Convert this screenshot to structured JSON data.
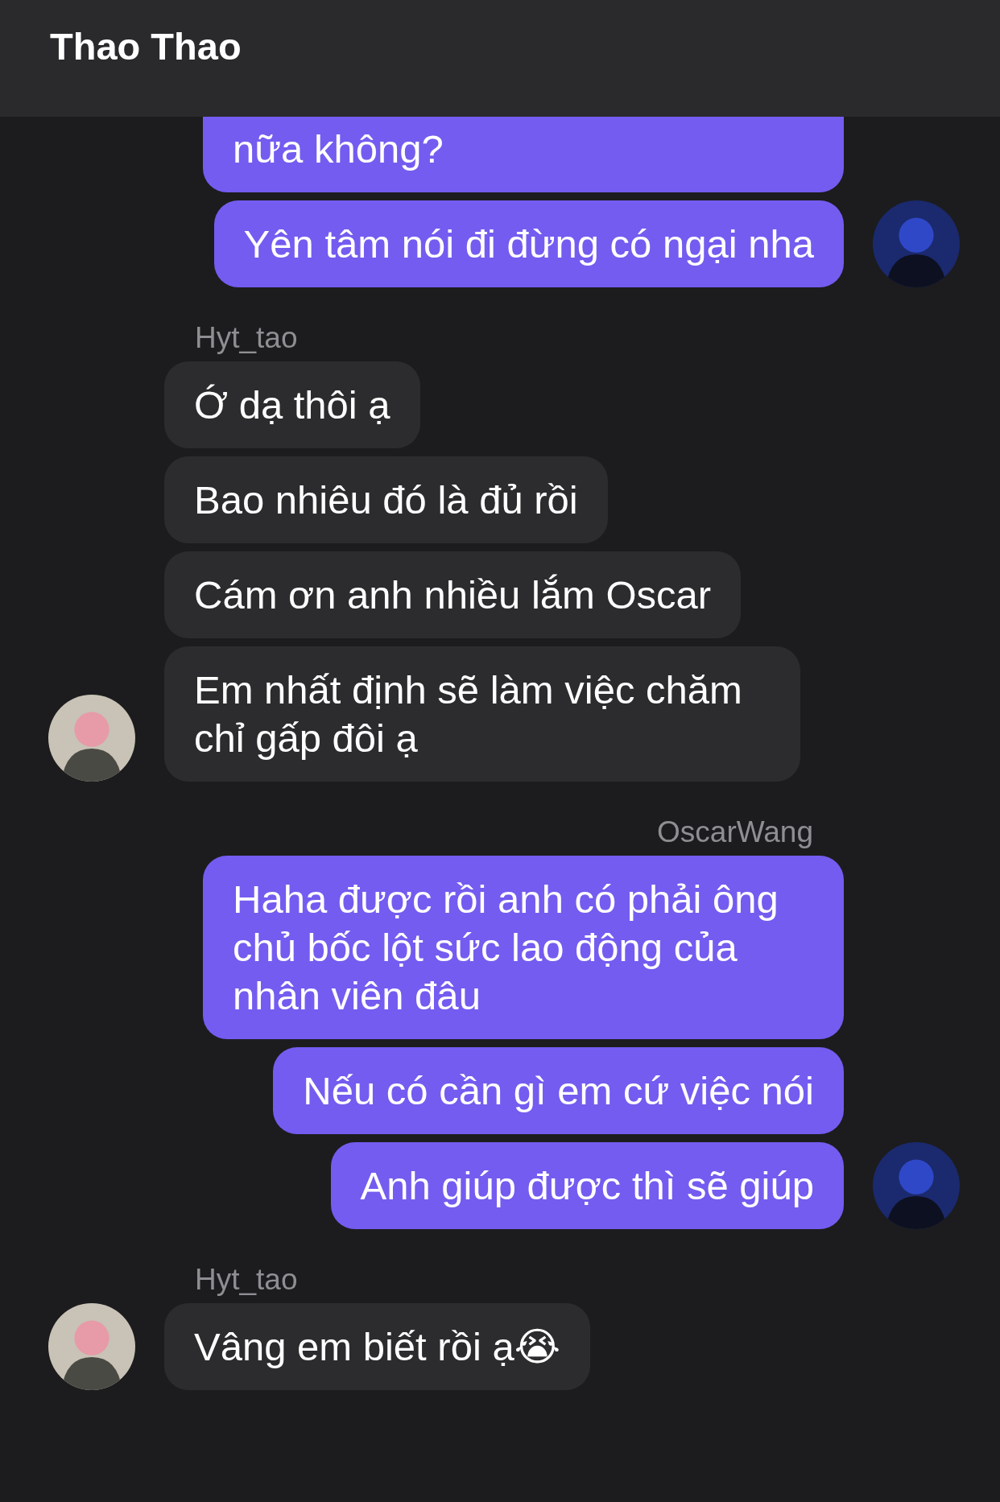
{
  "header": {
    "title": "Thao Thao"
  },
  "groups": [
    {
      "kind": "sent",
      "avatar": true,
      "bubbles": [
        {
          "text": "nữa không?",
          "cut": true
        },
        {
          "text": "Yên tâm nói đi đừng có ngại nha",
          "cut": false
        }
      ]
    },
    {
      "kind": "received",
      "sender": "Hyt_tao",
      "avatar": true,
      "bubbles": [
        {
          "text": "Ớ dạ thôi ạ",
          "cut": false
        },
        {
          "text": "Bao nhiêu đó là đủ rồi",
          "cut": false
        },
        {
          "text": "Cám ơn anh nhiều lắm Oscar",
          "cut": false
        },
        {
          "text": "Em nhất định sẽ làm việc chăm chỉ gấp đôi ạ",
          "cut": false
        }
      ]
    },
    {
      "kind": "sent",
      "sender": "OscarWang",
      "avatar": true,
      "bubbles": [
        {
          "text": "Haha được rồi anh có phải ông chủ bốc lột sức lao động của nhân viên đâu",
          "cut": false
        },
        {
          "text": "Nếu có cần gì em cứ việc nói",
          "cut": false
        },
        {
          "text": "Anh giúp được thì sẽ giúp",
          "cut": false
        }
      ]
    },
    {
      "kind": "received",
      "sender": "Hyt_tao",
      "avatar": true,
      "bubbles": [
        {
          "text": "Vâng em biết rồi ạ😭",
          "cut": false
        }
      ]
    }
  ]
}
